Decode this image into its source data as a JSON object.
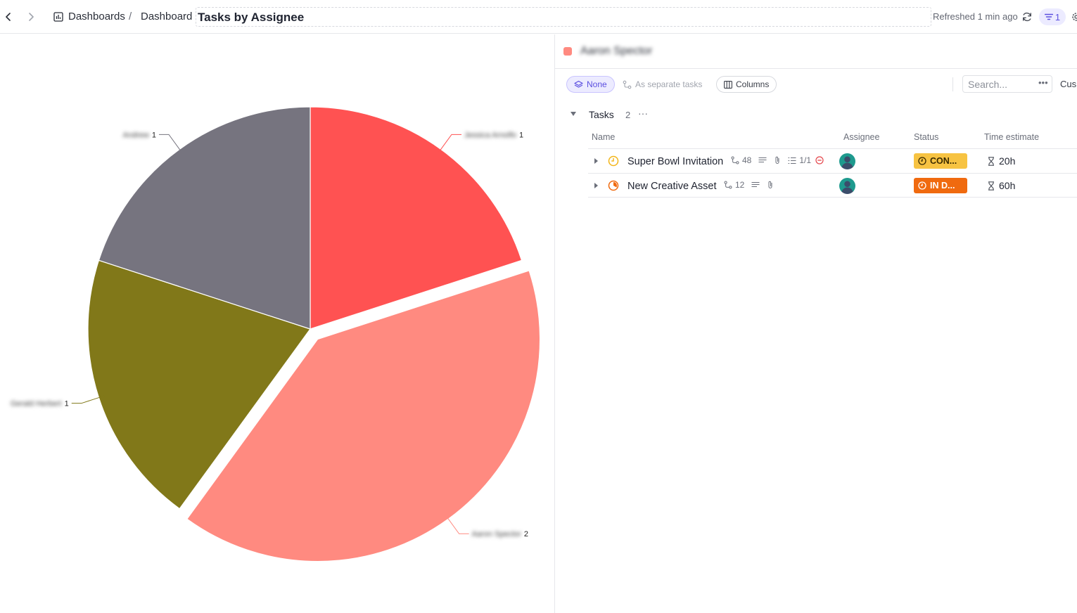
{
  "topbar": {
    "crumb_dashboards": "Dashboards",
    "crumb_separator": "/",
    "crumb_dashboard": "Dashboard",
    "title": "Tasks by Assignee",
    "refreshed": "Refreshed 1 min ago",
    "filter_count": "1"
  },
  "chart_data": {
    "type": "pie",
    "title": "",
    "slices": [
      {
        "label": "Aaron Spector",
        "value": 2,
        "color": "#FF8A80",
        "exploded": true
      },
      {
        "label": "Gerald Herbert",
        "value": 1,
        "color": "#817819",
        "exploded": false
      },
      {
        "label": "Andrew",
        "value": 1,
        "color": "#76747F",
        "exploded": false
      },
      {
        "label": "Jessica Arnolfo",
        "value": 1,
        "color": "#FF5252",
        "exploded": false
      }
    ],
    "legend": "none",
    "labels": "outside with leader lines (names blurred)"
  },
  "panel": {
    "selected_name": "Aaron Spector",
    "selected_color": "#FF8A80",
    "chip_none": "None",
    "chip_separate": "As separate tasks",
    "chip_columns": "Columns",
    "search_placeholder": "Search...",
    "customize_stub": "Cus",
    "group_label": "Tasks",
    "group_count": "2",
    "columns": {
      "name": "Name",
      "assignee": "Assignee",
      "status": "Status",
      "time_estimate": "Time estimate"
    },
    "tasks": [
      {
        "name": "Super Bowl Invitation",
        "subtasks": "48",
        "checklist": "1/1",
        "status": "CON...",
        "status_color": "#F7C342",
        "status_text_color": "#3a2a00",
        "time": "20h"
      },
      {
        "name": "New Creative Asset",
        "subtasks": "12",
        "status": "IN D...",
        "status_color": "#F06A0F",
        "status_text_color": "#ffffff",
        "time": "60h"
      }
    ]
  }
}
